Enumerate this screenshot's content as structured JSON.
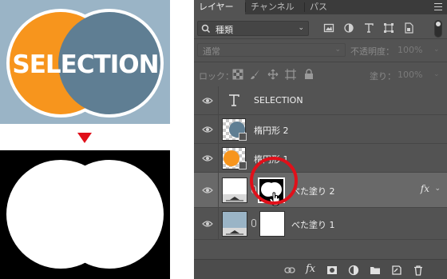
{
  "artwork": {
    "logo_text": "SELECTION",
    "colors": {
      "orange": "#f7951d",
      "blue": "#5f7e93",
      "background": "#9ab4c6",
      "white": "#ffffff",
      "arrow": "#e0101a"
    }
  },
  "panel": {
    "tabs": [
      {
        "label": "レイヤー",
        "active": true
      },
      {
        "label": "チャンネル",
        "active": false
      },
      {
        "label": "パス",
        "active": false
      }
    ],
    "filter": {
      "kind_label": "種類",
      "icons": [
        "image-filter-icon",
        "adjustment-filter-icon",
        "type-filter-icon",
        "shape-filter-icon",
        "smart-object-filter-icon"
      ]
    },
    "blend_mode": "通常",
    "opacity_label": "不透明度：",
    "opacity_value": "100%",
    "lock_label": "ロック：",
    "fill_label": "塗り：",
    "fill_value": "100%",
    "layers": [
      {
        "name": "SELECTION",
        "kind": "text",
        "visible": true,
        "selected": false
      },
      {
        "name": "楕円形 2",
        "kind": "shape",
        "visible": true,
        "selected": false
      },
      {
        "name": "楕円形 1",
        "kind": "shape",
        "visible": true,
        "selected": false
      },
      {
        "name": "べた塗り 2",
        "kind": "fill",
        "visible": true,
        "selected": true,
        "fx": "fx"
      },
      {
        "name": "べた塗り 1",
        "kind": "fill",
        "visible": true,
        "selected": false
      }
    ],
    "bottom_fx": "fx"
  }
}
